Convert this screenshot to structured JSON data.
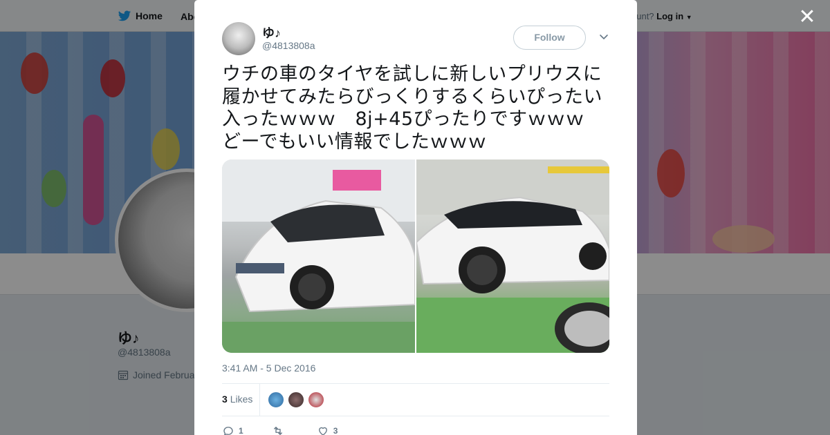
{
  "topbar": {
    "home_label": "Home",
    "about_label": "Abo",
    "login_prefix": "ccount?",
    "login_label": "Log in",
    "icons": [
      "twitter-bird-icon",
      "chevron-down-icon"
    ]
  },
  "profile": {
    "name": "ゆ♪",
    "handle": "@4813808a",
    "joined_label": "Joined Februa"
  },
  "modal": {
    "close_icon": "close-icon",
    "author_name": "ゆ♪",
    "author_handle": "@4813808a",
    "follow_label": "Follow",
    "tweet_text": "ウチの車のタイヤを試しに新しいプリウスに履かせてみたらびっくりするくらいぴったい入ったｗｗｗ　8j+45ぴったりですｗｗｗ　どーでもいい情報でしたｗｗｗ",
    "timestamp": "3:41 AM - 5 Dec 2016",
    "likes_count": "3",
    "likes_label": "Likes",
    "reply_count": "1",
    "retweet_count": "",
    "like_count": "3",
    "photos": [
      "photo-white-prius-front",
      "photo-white-prius-side"
    ]
  },
  "colors": {
    "text_primary": "#14171a",
    "text_secondary": "#657786",
    "twitter_blue": "#1da1f2",
    "border": "#e6ecf0"
  }
}
